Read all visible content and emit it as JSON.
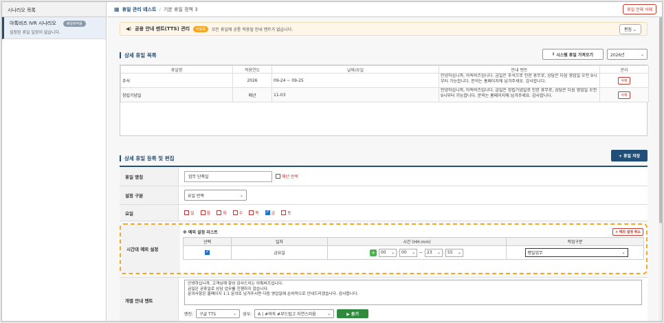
{
  "sidebar": {
    "header": "시나리오 목록",
    "item": {
      "title": "아톡비즈 IVR 시나리오",
      "badge": "휴일비적용",
      "subtitle": "설정된 휴일 일정이 없습니다."
    }
  },
  "topbar": {
    "title": "휴일 관리 테스트",
    "separator": "/",
    "subtitle": "기본 휴일 정책 3",
    "delete_all": "휴일 전체 삭제"
  },
  "notice": {
    "title": "공용 안내 멘트(TTS) 관리",
    "badge": "미등록",
    "desc": "모든 휴일에 공통 적용될 안내 멘트가 없습니다.",
    "edit": "편집"
  },
  "list_section": {
    "title": "상세 휴일 목록",
    "import_btn": "시스템 휴일 가져오기",
    "year": "2026년"
  },
  "holiday_table": {
    "headers": [
      "휴일명",
      "적용연도",
      "날짜/요일",
      "안내 멘트",
      "관리"
    ],
    "rows": [
      {
        "name": "추석",
        "year": "2026",
        "date": "09-24 ~ 09-25",
        "ment": "안녕하십니까, 아톡비즈입니다. 금일은 추석으로 인한 휴무로, 상담은 다음 영업일 오전 9시부터 가능합니다. 문의는 홈페이지에 남겨주세요. 감사합니다.",
        "action": "삭제"
      },
      {
        "name": "창립기념일",
        "year": "매년",
        "date": "11-03",
        "ment": "안녕하십니까, 아톡비즈입니다. 금일은 창립기념일로 인한 휴무로, 상담은 다음 영업일 오전 9시부터 가능합니다. 문의는 홈페이지에 남겨주세요. 감사합니다.",
        "action": "삭제"
      }
    ]
  },
  "form_section": {
    "title": "상세 휴일 등록 및 편집",
    "save_btn": "+ 휴일 저장"
  },
  "form": {
    "name_label": "휴일 명칭",
    "name_value": "업무 단축일",
    "repeat_label": "매년 반복",
    "type_label": "설정 구분",
    "type_value": "요일 반복",
    "day_label": "요일",
    "days": [
      {
        "label": "일",
        "checked": false
      },
      {
        "label": "월",
        "checked": false
      },
      {
        "label": "화",
        "checked": false
      },
      {
        "label": "수",
        "checked": false
      },
      {
        "label": "목",
        "checked": false
      },
      {
        "label": "금",
        "checked": true
      },
      {
        "label": "토",
        "checked": false
      }
    ]
  },
  "exception": {
    "label": "시간대 예외 설정",
    "list_title": "※ 예외 설정 리스트",
    "cancel": "× 예외 설정 취소",
    "headers": [
      "선택",
      "일자",
      "시간 (HH:mm)",
      "작업구분"
    ],
    "row": {
      "day": "금요일",
      "start_h": "00",
      "start_m": "00",
      "tilde": "~",
      "end_h": "23",
      "end_m": "55",
      "work": "평일업무"
    }
  },
  "ment": {
    "label": "개별 안내 멘트",
    "lines": [
      "안녕하십니까, 고객님께 항상 감사드리는 아톡비즈입니다.",
      "금일은 공휴일로 상담 업무를 진행하지 않습니다.",
      "문의사항은 홈페이지 1:1 문의로 남겨주시면 다음 영업일에 순차적으로 안내드리겠습니다. 감사합니다."
    ],
    "engine_label": "엔진:",
    "engine": "구글 TTS",
    "voice_label": "성우:",
    "voice": "A | #여자 #부드럽고 자연스러움",
    "play": "▶ 듣기"
  }
}
